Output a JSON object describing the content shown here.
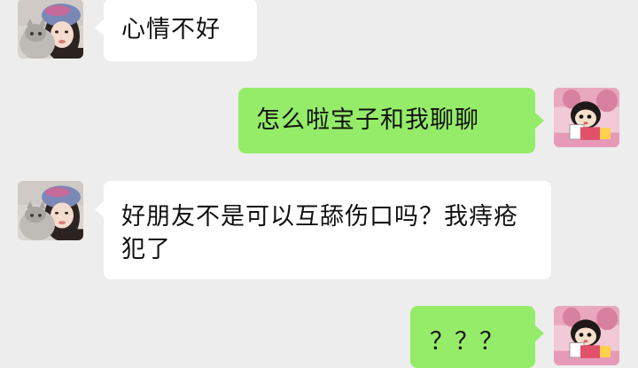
{
  "conversation": {
    "messages": [
      {
        "sender": "other",
        "avatar": "girl-with-cat-avatar",
        "text": "心情不好"
      },
      {
        "sender": "me",
        "avatar": "cartoon-girl-avatar",
        "text": "怎么啦宝子和我聊聊"
      },
      {
        "sender": "other",
        "avatar": "girl-with-cat-avatar",
        "text": "好朋友不是可以互舔伤口吗？我痔疮犯了"
      },
      {
        "sender": "me",
        "avatar": "cartoon-girl-avatar",
        "text": "？？？"
      }
    ]
  },
  "colors": {
    "background": "#ededed",
    "my_bubble": "#95ec69",
    "other_bubble": "#ffffff"
  }
}
